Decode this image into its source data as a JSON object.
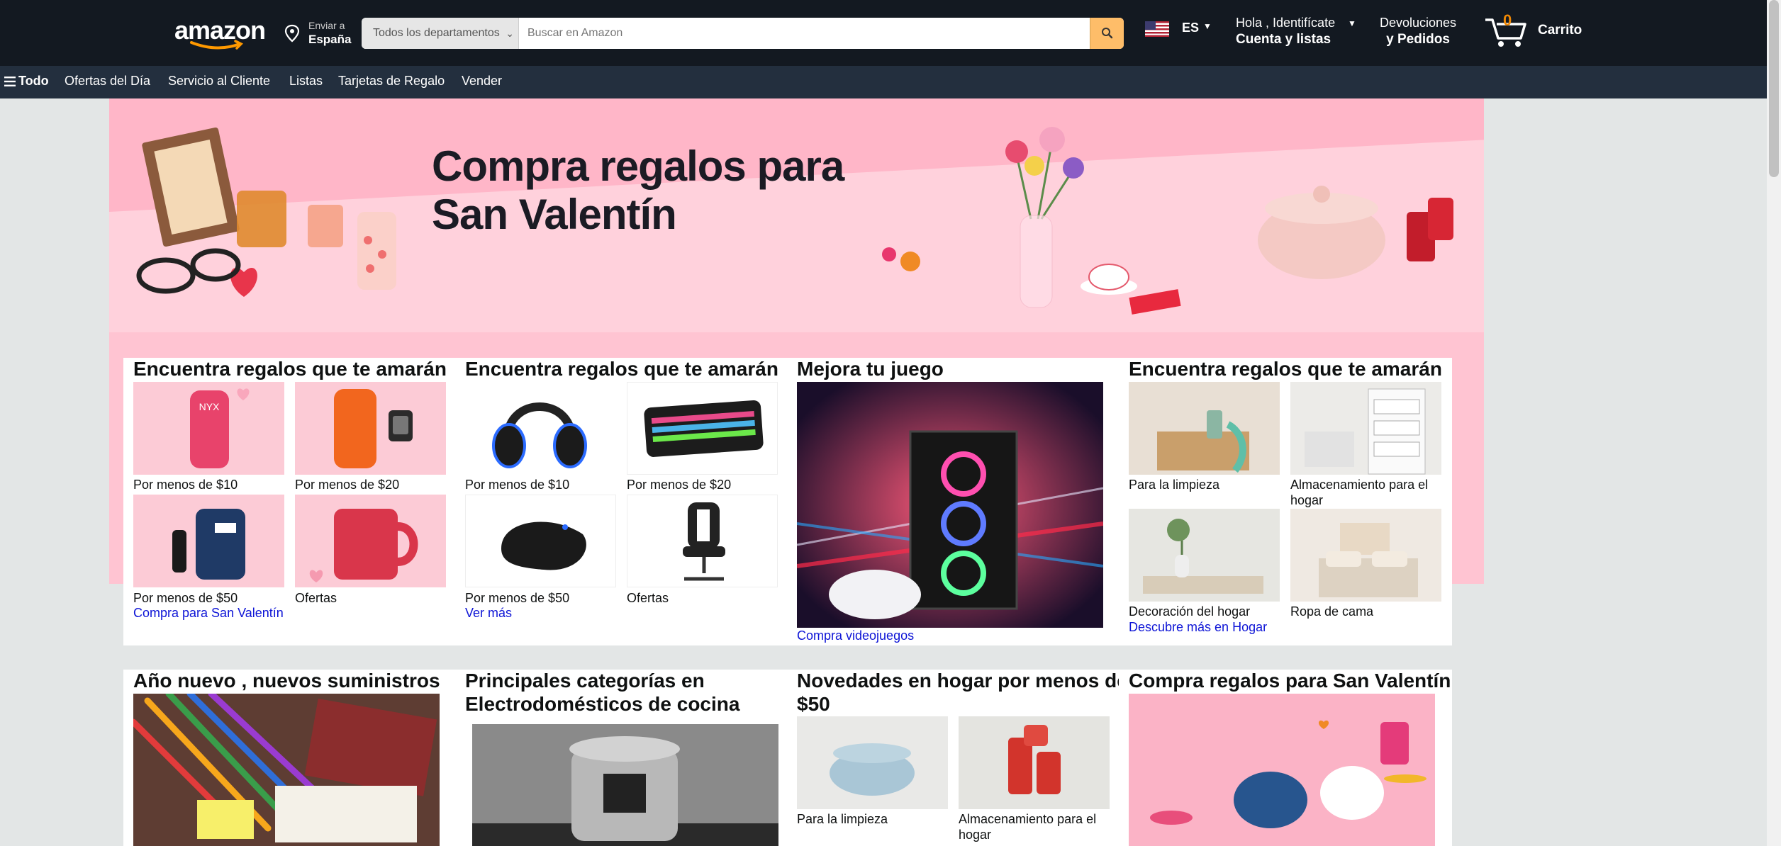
{
  "header": {
    "logo": "amazon",
    "deliver_label": "Enviar a",
    "deliver_location": "España",
    "dept_selected": "Todos los departamentos",
    "search_placeholder": "Buscar en Amazon",
    "lang_code": "ES",
    "account_line1": "Hola , Identifícate",
    "account_line2": "Cuenta y listas",
    "orders_line1": "Devoluciones",
    "orders_line2": "y Pedidos",
    "cart_count": "0",
    "cart_label": "Carrito",
    "icons": [
      "location-pin-icon",
      "search-icon",
      "us-flag-icon",
      "cart-icon",
      "hamburger-icon"
    ]
  },
  "subnav": {
    "all": "Todo",
    "items": [
      "Ofertas del Día",
      "Servicio al Cliente",
      "Listas",
      "Tarjetas de Regalo",
      "Vender"
    ]
  },
  "hero": {
    "title_line1": "Compra regalos para",
    "title_line2": "San Valentín"
  },
  "cards": [
    {
      "title": "Encuentra regalos que te amarán",
      "tiles": [
        "Por menos de $10",
        "Por menos de $20",
        "Por menos de $50",
        "Ofertas"
      ],
      "link": "Compra para San Valentín"
    },
    {
      "title": "Encuentra regalos que te amarán",
      "tiles": [
        "Por menos de $10",
        "Por menos de $20",
        "Por menos de $50",
        "Ofertas"
      ],
      "link": "Ver más"
    },
    {
      "title": "Mejora tu juego",
      "link": "Compra videojuegos"
    },
    {
      "title": "Encuentra regalos que te amarán",
      "tiles": [
        "Para la limpieza",
        "Almacenamiento para el hogar",
        "Decoración del hogar",
        "Ropa de cama"
      ],
      "link": "Descubre más en Hogar"
    },
    {
      "title": "Año nuevo , nuevos suministros"
    },
    {
      "title_line1": "Principales categorías en",
      "title_line2": "Electrodomésticos de cocina"
    },
    {
      "title_line1": "Novedades en hogar por menos de",
      "title_line2": "$50",
      "tiles": [
        "Para la limpieza",
        "Almacenamiento para el hogar"
      ]
    },
    {
      "title": "Compra regalos para San Valentín"
    }
  ],
  "colors": {
    "nav_bg": "#131921",
    "subnav_bg": "#232f3e",
    "search_btn": "#febd69",
    "link": "#0d14d6",
    "hero_pink": "#ffb6c8",
    "page_bg": "#e3e6e6"
  }
}
